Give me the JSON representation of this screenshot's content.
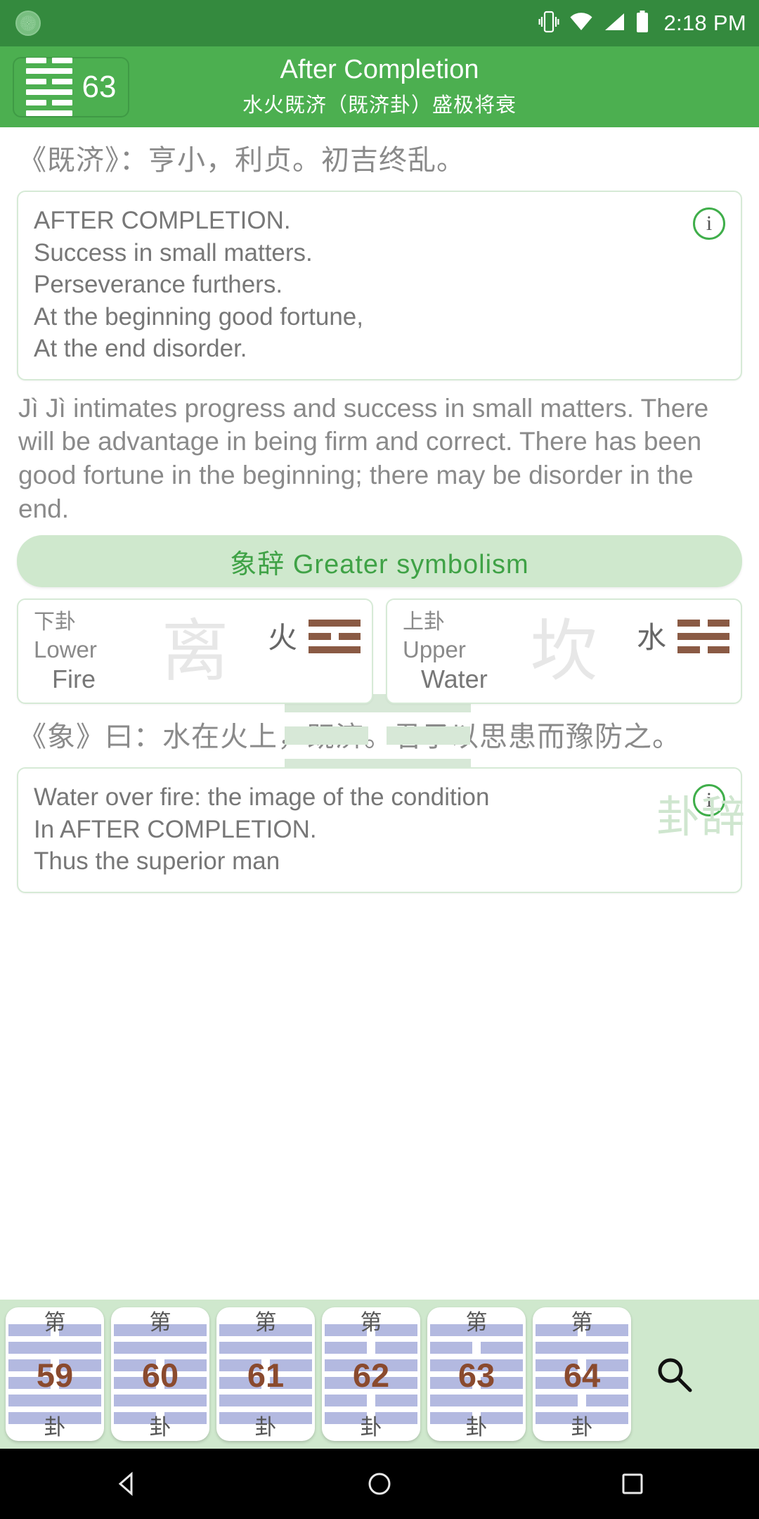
{
  "status_bar": {
    "time": "2:18 PM",
    "app_icon": "app-notification-icon",
    "icons": [
      "vibrate-icon",
      "wifi-icon",
      "signal-icon",
      "battery-icon"
    ]
  },
  "app_bar": {
    "hexagram_number": "63",
    "hexagram_glyph": "hexagram-63-icon",
    "title_en": "After Completion",
    "title_cn": "水火既济（既济卦）盛极将衰"
  },
  "judgement": {
    "chinese_line": "《既济》：亨小，利贞。初吉终乱。",
    "card_lines": [
      "AFTER COMPLETION.",
      "Success in small matters.",
      "Perseverance furthers.",
      "At the beginning good fortune,",
      "At the end disorder."
    ],
    "info_icon": "info-icon",
    "paragraph": "Jì Jì intimates progress and success in small matters. There will be advantage in being firm and correct. There has been good fortune in the beginning; there may be disorder in the end.",
    "watermark_text": "卦辞"
  },
  "symbolism": {
    "bar_label": "象辞 Greater symbolism",
    "trigrams": [
      {
        "position_cn": "下卦",
        "position_en": "Lower",
        "watermark_char": "离",
        "element_cn": "火",
        "element_en": "Fire",
        "lines": [
          "yang",
          "yin",
          "yang"
        ],
        "icon": "trigram-li-icon"
      },
      {
        "position_cn": "上卦",
        "position_en": "Upper",
        "watermark_char": "坎",
        "element_cn": "水",
        "element_en": "Water",
        "lines": [
          "yin",
          "yang",
          "yin"
        ],
        "icon": "trigram-kan-icon"
      }
    ],
    "chinese_line": "《象》曰：水在火上，既济。君子以思患而豫防之。",
    "card_lines": [
      "Water over fire: the image of the condition",
      "In AFTER COMPLETION.",
      "Thus the superior man"
    ],
    "info_icon": "info-icon"
  },
  "bottom_nav": {
    "prefix": "第",
    "suffix": "卦",
    "search_icon": "search-icon",
    "cards": [
      {
        "number": "59",
        "lines": [
          "yang",
          "yang",
          "yin",
          "yin",
          "yang",
          "yin"
        ]
      },
      {
        "number": "60",
        "lines": [
          "yin",
          "yang",
          "yin",
          "yin",
          "yang",
          "yang"
        ]
      },
      {
        "number": "61",
        "lines": [
          "yang",
          "yang",
          "yin",
          "yin",
          "yang",
          "yang"
        ]
      },
      {
        "number": "62",
        "lines": [
          "yin",
          "yin",
          "yang",
          "yang",
          "yin",
          "yin"
        ]
      },
      {
        "number": "63",
        "lines": [
          "yin",
          "yang",
          "yin",
          "yang",
          "yin",
          "yang"
        ]
      },
      {
        "number": "64",
        "lines": [
          "yang",
          "yin",
          "yang",
          "yin",
          "yang",
          "yin"
        ]
      }
    ]
  },
  "android_nav": {
    "back": "back-triangle-icon",
    "home": "home-circle-icon",
    "recents": "recents-square-icon"
  },
  "colors": {
    "status_bar": "#348a3e",
    "app_bar": "#4caf50",
    "accent_green": "#3fa246",
    "light_green": "#cfe8cd",
    "trigram_brown": "#8a5a44",
    "hexbar_blue": "#b3b9e0",
    "card_number": "#8a4a2e"
  }
}
